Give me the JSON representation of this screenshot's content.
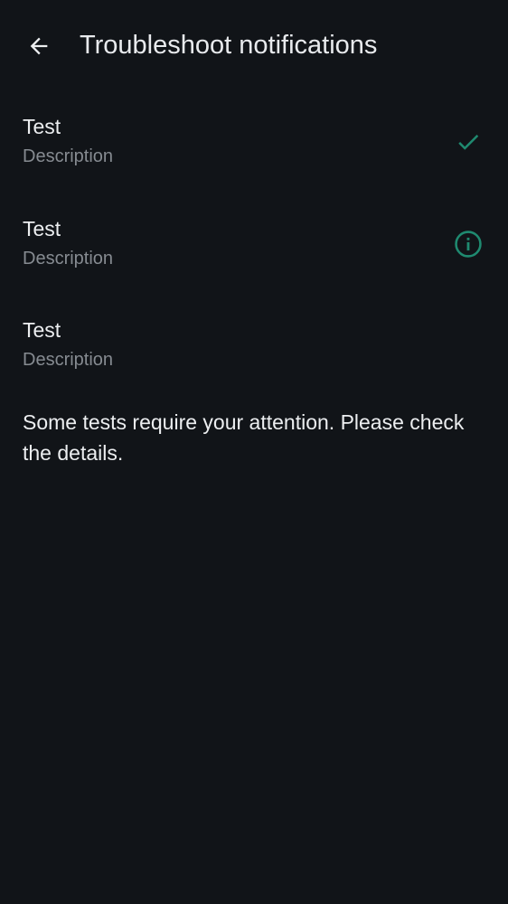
{
  "app_bar": {
    "back_icon": "arrow-back-icon",
    "title": "Troubleshoot notifications"
  },
  "colors": {
    "background": "#111418",
    "accent": "#1f8a70",
    "text_primary": "#eceef0",
    "text_secondary": "#868b91"
  },
  "tests": [
    {
      "title": "Test",
      "description": "Description",
      "status_icon": "check-icon"
    },
    {
      "title": "Test",
      "description": "Description",
      "status_icon": "info-icon"
    },
    {
      "title": "Test",
      "description": "Description",
      "status_icon": ""
    }
  ],
  "status_message": "Some tests require your attention. Please check the details."
}
